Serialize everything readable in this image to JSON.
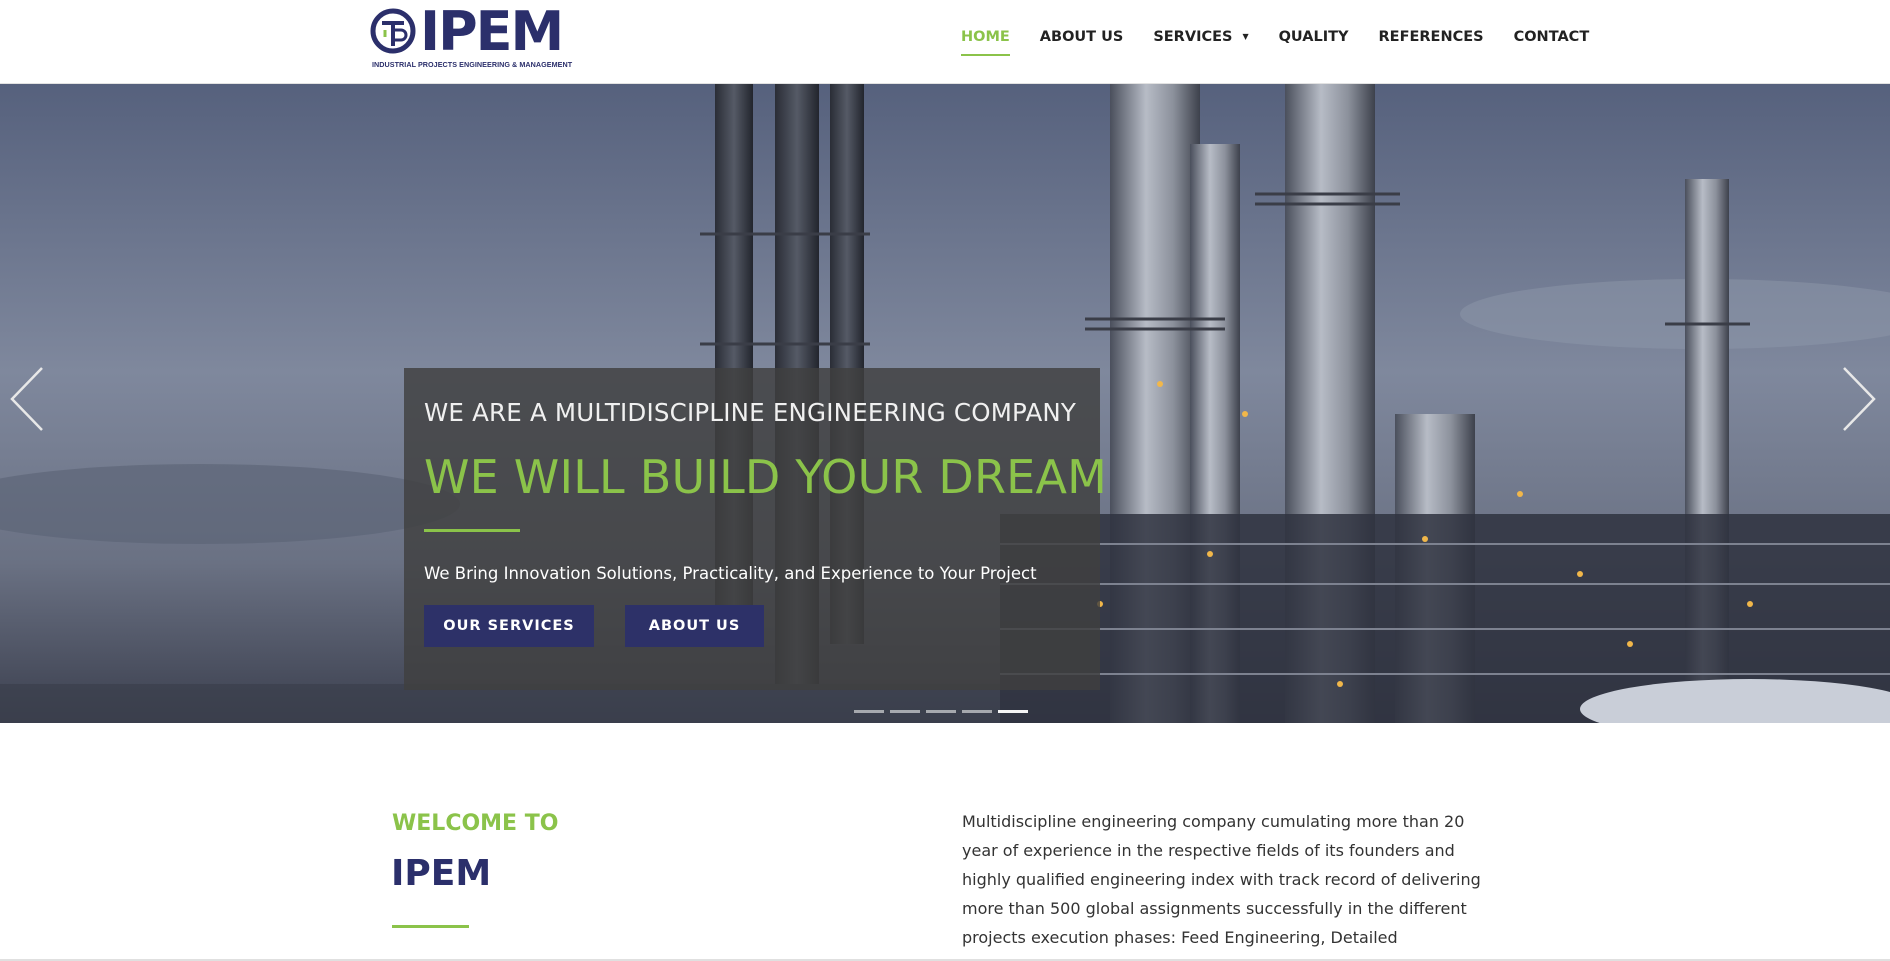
{
  "brand": {
    "name": "IPEM",
    "tagline": "INDUSTRIAL PROJECTS ENGINEERING & MANAGEMENT",
    "primary_color": "#2b2f6b",
    "accent_color": "#8bc34a"
  },
  "nav": {
    "items": [
      {
        "label": "HOME",
        "active": true
      },
      {
        "label": "ABOUT US"
      },
      {
        "label": "SERVICES",
        "has_dropdown": true,
        "icon": "caret-down-icon"
      },
      {
        "label": "QUALITY"
      },
      {
        "label": "REFERENCES"
      },
      {
        "label": "CONTACT"
      }
    ]
  },
  "hero": {
    "subtitle": "WE ARE A MULTIDISCIPLINE ENGINEERING COMPANY",
    "title": "WE WILL BUILD YOUR DREAM",
    "text": "We Bring Innovation Solutions, Practicality, and Experience to Your Project",
    "buttons": [
      {
        "label": "OUR SERVICES"
      },
      {
        "label": "ABOUT US"
      }
    ],
    "prev_icon": "chevron-left-icon",
    "next_icon": "chevron-right-icon",
    "slide_count": 5,
    "active_slide": 1
  },
  "welcome": {
    "kicker": "WELCOME TO",
    "title": "IPEM",
    "body": "Multidiscipline engineering company cumulating more than 20 year of experience in the respective fields of its founders and highly qualified engineering index with track record of delivering more than 500 global assignments successfully in the different projects execution phases: Feed Engineering, Detailed Engineering, Procurement Management,"
  }
}
